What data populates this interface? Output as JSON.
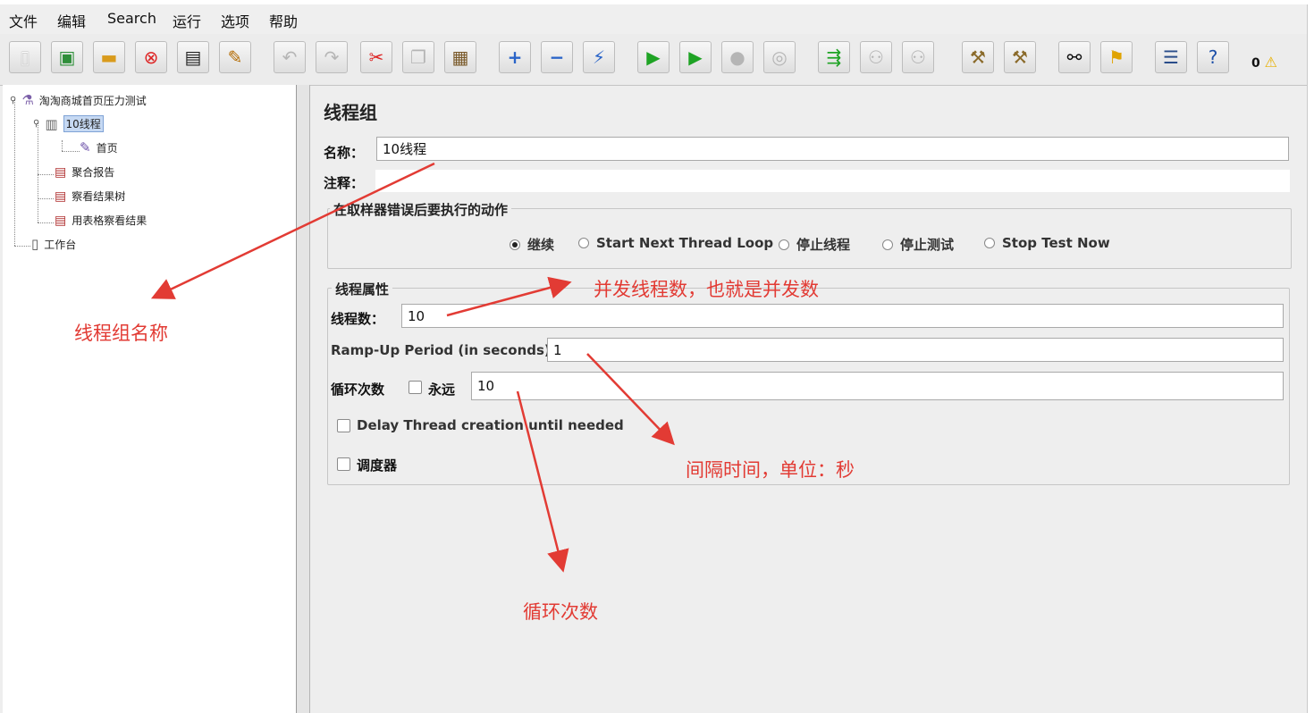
{
  "menu": [
    "文件",
    "编辑",
    "Search",
    "运行",
    "选项",
    "帮助"
  ],
  "toolbar": {
    "warning_count": "0"
  },
  "tree": {
    "root": "淘淘商城首页压力测试",
    "thread_group": "10线程",
    "sampler": "首页",
    "listeners": [
      "聚合报告",
      "察看结果树",
      "用表格察看结果"
    ],
    "workbench": "工作台"
  },
  "panel": {
    "title": "线程组",
    "name_label": "名称：",
    "name_value": "10线程",
    "comment_label": "注释：",
    "comment_value": "",
    "error_action_legend": "在取样器错误后要执行的动作",
    "error_actions": [
      "继续",
      "Start Next Thread Loop",
      "停止线程",
      "停止测试",
      "Stop Test Now"
    ],
    "error_action_selected": 0,
    "props_legend": "线程属性",
    "threads_label": "线程数：",
    "threads_value": "10",
    "rampup_label": "Ramp-Up Period (in seconds):",
    "rampup_value": "1",
    "loop_label": "循环次数",
    "forever_label": "永远",
    "forever_checked": false,
    "loop_value": "10",
    "delay_label": "Delay Thread creation until needed",
    "delay_checked": false,
    "scheduler_label": "调度器",
    "scheduler_checked": false
  },
  "annotations": {
    "group_name": "线程组名称",
    "threads": "并发线程数，也就是并发数",
    "rampup": "间隔时间，单位：秒",
    "loops": "循环次数"
  },
  "colors": {
    "annotation": "#e23b34",
    "selection": "#c6d9f3"
  }
}
